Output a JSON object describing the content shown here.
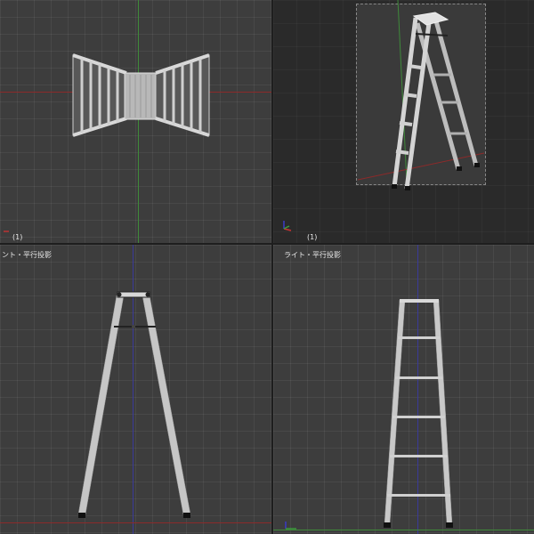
{
  "viewports": {
    "top": {
      "frame_label": "(1)"
    },
    "perspective": {
      "frame_label": "(1)"
    },
    "front": {
      "title": "ント・平行投影"
    },
    "right": {
      "title": "ライト・平行投影"
    }
  },
  "colors": {
    "viewport_bg": "#3d3d3d",
    "persp_bg": "#2a2a2a",
    "x_axis": "#8c2a2a",
    "y_axis": "#3f8a3a",
    "z_axis": "#3a3a9a",
    "ladder": "#c9c9c9"
  },
  "icons": [
    "axis-gizmo-icon"
  ]
}
